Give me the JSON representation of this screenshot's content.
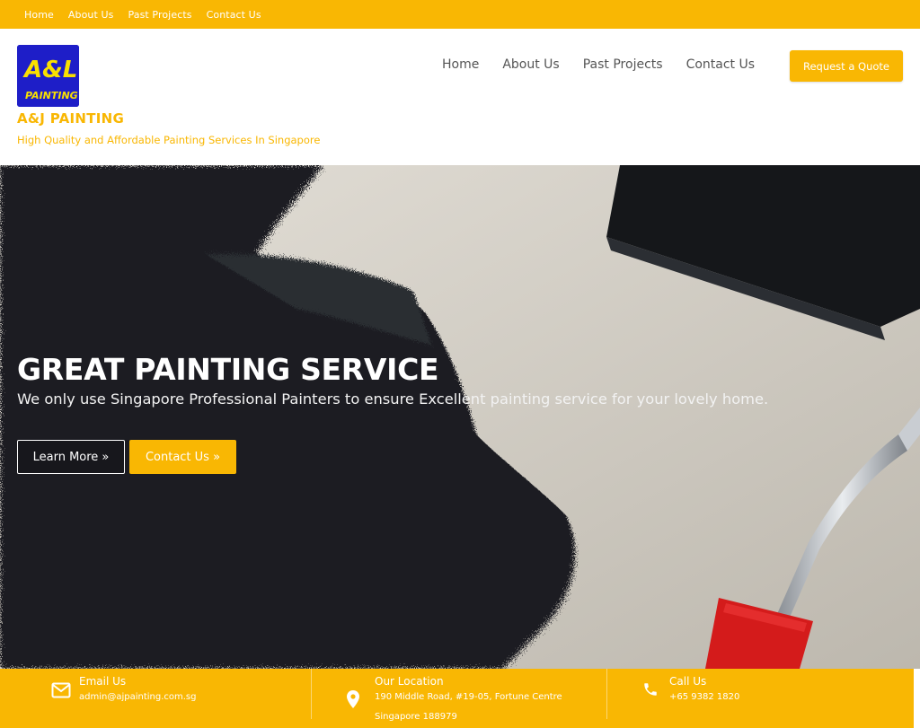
{
  "topbar": {
    "links": [
      "Home",
      "About Us",
      "Past Projects",
      "Contact Us"
    ]
  },
  "header": {
    "logo_text_top": "A&L",
    "logo_text_bottom": "PAINTING",
    "site_title": "A&J PAINTING",
    "tagline": "High Quality and Affordable Painting Services In Singapore",
    "nav": [
      "Home",
      "About Us",
      "Past Projects",
      "Contact Us"
    ],
    "quote_button": "Request a Quote"
  },
  "hero": {
    "title": "GREAT PAINTING SERVICE",
    "subtitle": "We only use Singapore Professional Painters to ensure Excellent painting service for your lovely home.",
    "learn_more": "Learn More »",
    "contact_us": "Contact Us »"
  },
  "info": {
    "email": {
      "icon": "envelope-icon",
      "title": "Email Us",
      "lines": [
        "admin@ajpainting.com.sg"
      ]
    },
    "location": {
      "icon": "map-pin-icon",
      "title": "Our Location",
      "lines": [
        "190 Middle Road, #19-05, Fortune Centre",
        "Singapore 188979"
      ]
    },
    "call": {
      "icon": "phone-icon",
      "title": "Call Us",
      "lines": [
        "+65 9382 1820"
      ]
    }
  },
  "colors": {
    "accent": "#F9B703",
    "logo_bg": "#1E1EC8",
    "hero_dark": "#1c1f24",
    "hero_wall": "#d8d4cc",
    "roller_handle_red": "#d41b1b"
  }
}
